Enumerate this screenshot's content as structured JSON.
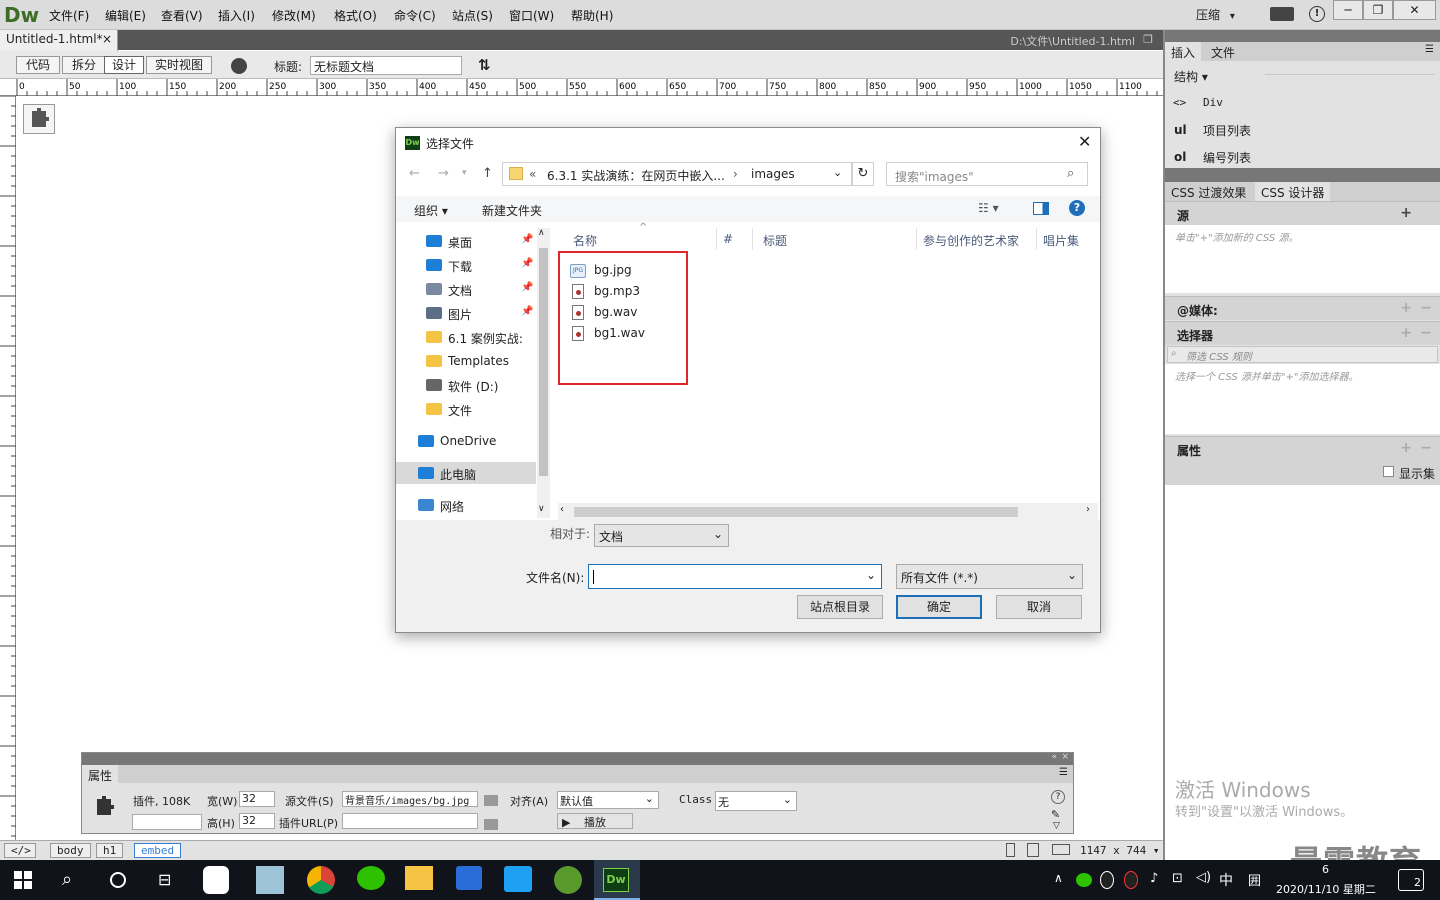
{
  "app": {
    "logo": "Dw",
    "menu": [
      "文件(F)",
      "编辑(E)",
      "查看(V)",
      "插入(I)",
      "修改(M)",
      "格式(O)",
      "命令(C)",
      "站点(S)",
      "窗口(W)",
      "帮助(H)"
    ],
    "compress_label": "压缩",
    "compress_arrow": "▾",
    "window_controls": [
      "─",
      "❐",
      "✕"
    ]
  },
  "document": {
    "tab_label": "Untitled-1.html*",
    "tab_close": "×",
    "path": "D:\\文件\\Untitled-1.html",
    "restore_icon": "❐"
  },
  "toolbar": {
    "views": [
      "代码",
      "拆分",
      "设计",
      "实时视图"
    ],
    "title_label": "标题:",
    "title_value": "无标题文档"
  },
  "ruler": {
    "marks": [
      "0",
      "50",
      "100",
      "150",
      "200",
      "250",
      "300",
      "350",
      "400",
      "450",
      "500",
      "550",
      "600",
      "650",
      "700",
      "750",
      "800",
      "850",
      "900",
      "950",
      "1000",
      "1050",
      "1100"
    ]
  },
  "right_panel": {
    "tabs_top": [
      "插入",
      "文件"
    ],
    "structure_label": "结构 ▾",
    "insert_items": [
      {
        "tag": "<>",
        "label": "Div"
      },
      {
        "tag": "ul",
        "label": "项目列表"
      },
      {
        "tag": "ol",
        "label": "编号列表"
      }
    ],
    "tabs_css": [
      "CSS 过渡效果",
      "CSS 设计器"
    ],
    "source_header": "源",
    "source_hint": "单击\"+\"添加新的 CSS 源。",
    "media_header": "@媒体:",
    "selector_header": "选择器",
    "selector_filter_placeholder": "筛选 CSS 规则",
    "selector_hint": "选择一个 CSS 源并单击\"+\"添加选择器。",
    "properties_header": "属性",
    "show_set_label": "显示集",
    "activate_title": "激活 Windows",
    "activate_sub": "转到\"设置\"以激活 Windows。",
    "watermark": "最需教育"
  },
  "dialog": {
    "title": "选择文件",
    "breadcrumb": [
      "«",
      "6.3.1  实战演练：在网页中嵌入...",
      "›",
      "images"
    ],
    "search_placeholder": "搜索\"images\"",
    "organize_label": "组织 ▾",
    "new_folder_label": "新建文件夹",
    "columns": [
      "名称",
      "#",
      "标题",
      "参与创作的艺术家",
      "唱片集"
    ],
    "nav_items": [
      {
        "label": "桌面",
        "icon": "desktop-icon",
        "pinned": true
      },
      {
        "label": "下载",
        "icon": "download-icon",
        "pinned": true
      },
      {
        "label": "文档",
        "icon": "document-icon",
        "pinned": true
      },
      {
        "label": "图片",
        "icon": "picture-icon",
        "pinned": true
      },
      {
        "label": "6.1  案例实战:",
        "icon": "folder-icon",
        "pinned": false
      },
      {
        "label": "Templates",
        "icon": "folder-icon",
        "pinned": false
      },
      {
        "label": "软件 (D:)",
        "icon": "drive-icon",
        "pinned": false
      },
      {
        "label": "文件",
        "icon": "folder-icon",
        "pinned": false
      },
      {
        "label": "OneDrive",
        "icon": "cloud-icon",
        "pinned": false
      },
      {
        "label": "此电脑",
        "icon": "computer-icon",
        "pinned": false
      },
      {
        "label": "网络",
        "icon": "network-icon",
        "pinned": false
      }
    ],
    "files": [
      {
        "name": "bg.jpg",
        "type": "jpg"
      },
      {
        "name": "bg.mp3",
        "type": "audio"
      },
      {
        "name": "bg.wav",
        "type": "audio"
      },
      {
        "name": "bg1.wav",
        "type": "audio"
      }
    ],
    "relative_label": "相对于:",
    "relative_value": "文档",
    "filename_label": "文件名(N):",
    "filename_value": "",
    "filetype_value": "所有文件 (*.*)",
    "site_root_button": "站点根目录",
    "ok_button": "确定",
    "cancel_button": "取消",
    "highlight_color": "#e0262b"
  },
  "properties": {
    "tab_label": "属性",
    "plugin_label": "插件, 108K",
    "width_label": "宽(W)",
    "width_value": "32",
    "height_label": "高(H)",
    "height_value": "32",
    "src_label": "源文件(S)",
    "src_value": "背景音乐/images/bg.jpg",
    "plugin_url_label": "插件URL(P)",
    "align_label": "对齐(A)",
    "align_value": "默认值",
    "class_label": "Class",
    "class_value": "无",
    "play_label": "播放"
  },
  "status": {
    "tags": [
      "</>",
      "body",
      "h1",
      "embed"
    ],
    "size": "1147 x 744 ▾"
  },
  "taskbar": {
    "tray_ime": "中",
    "tray_grid": "囲",
    "time": "6",
    "date": "2020/11/10 星期二",
    "notification_count": "2"
  }
}
